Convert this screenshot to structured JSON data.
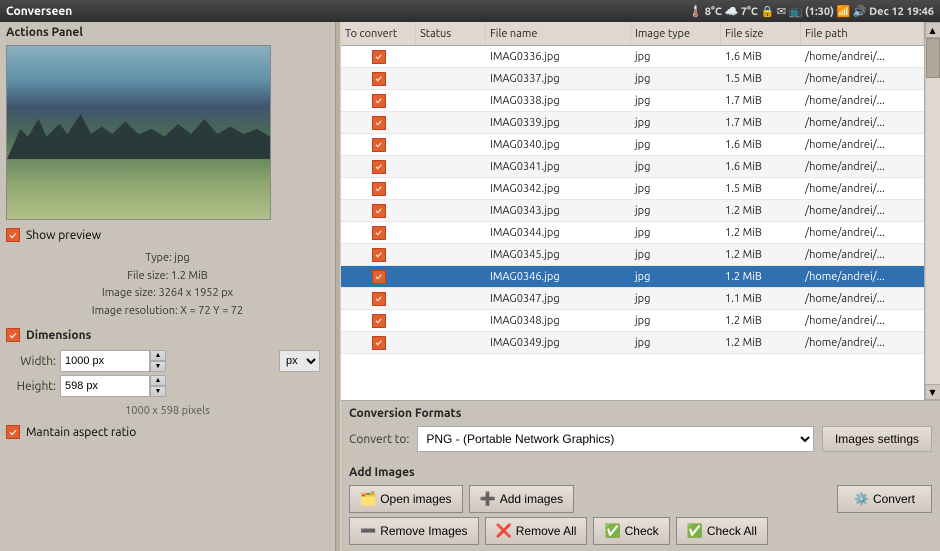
{
  "titlebar": {
    "title": "Converseen",
    "system_icons": "🌡️ 8°C  ☁️ 7°C  🔒  ✉  📺 (1:30)  📶  🔊  Dec 12 19:46"
  },
  "left_panel": {
    "title": "Actions Panel",
    "show_preview": "Show preview",
    "meta": {
      "type_label": "Type:",
      "type_value": "jpg",
      "filesize_label": "File size:",
      "filesize_value": "1.2 MiB",
      "imgsize_label": "Image size:",
      "imgsize_value": "3264 x 1952 px",
      "resolution_label": "Image resolution:",
      "resolution_value": "X = 72 Y = 72"
    },
    "dimensions": {
      "title": "Dimensions",
      "width_label": "Width:",
      "width_value": "1000 px",
      "height_label": "Height:",
      "height_value": "598 px",
      "pixels_display": "1000 x 598 pixels",
      "unit": "px",
      "maintain_label": "Mantain aspect ratio"
    }
  },
  "file_list": {
    "columns": [
      "To convert",
      "Status",
      "File name",
      "Image type",
      "File size",
      "File path"
    ],
    "rows": [
      {
        "filename": "IMAG0336.jpg",
        "type": "jpg",
        "size": "1.6 MiB",
        "path": "/home/andrei/..."
      },
      {
        "filename": "IMAG0337.jpg",
        "type": "jpg",
        "size": "1.5 MiB",
        "path": "/home/andrei/..."
      },
      {
        "filename": "IMAG0338.jpg",
        "type": "jpg",
        "size": "1.7 MiB",
        "path": "/home/andrei/..."
      },
      {
        "filename": "IMAG0339.jpg",
        "type": "jpg",
        "size": "1.7 MiB",
        "path": "/home/andrei/..."
      },
      {
        "filename": "IMAG0340.jpg",
        "type": "jpg",
        "size": "1.6 MiB",
        "path": "/home/andrei/..."
      },
      {
        "filename": "IMAG0341.jpg",
        "type": "jpg",
        "size": "1.6 MiB",
        "path": "/home/andrei/..."
      },
      {
        "filename": "IMAG0342.jpg",
        "type": "jpg",
        "size": "1.5 MiB",
        "path": "/home/andrei/..."
      },
      {
        "filename": "IMAG0343.jpg",
        "type": "jpg",
        "size": "1.2 MiB",
        "path": "/home/andrei/..."
      },
      {
        "filename": "IMAG0344.jpg",
        "type": "jpg",
        "size": "1.2 MiB",
        "path": "/home/andrei/..."
      },
      {
        "filename": "IMAG0345.jpg",
        "type": "jpg",
        "size": "1.2 MiB",
        "path": "/home/andrei/..."
      },
      {
        "filename": "IMAG0346.jpg",
        "type": "jpg",
        "size": "1.2 MiB",
        "path": "/home/andrei/..."
      },
      {
        "filename": "IMAG0347.jpg",
        "type": "jpg",
        "size": "1.1 MiB",
        "path": "/home/andrei/..."
      },
      {
        "filename": "IMAG0348.jpg",
        "type": "jpg",
        "size": "1.2 MiB",
        "path": "/home/andrei/..."
      },
      {
        "filename": "IMAG0349.jpg",
        "type": "jpg",
        "size": "1.2 MiB",
        "path": "/home/andrei/..."
      }
    ],
    "selected_row": 10
  },
  "conversion": {
    "section_title": "Conversion Formats",
    "convert_to_label": "Convert to:",
    "convert_to_value": "PNG - (Portable Network Graphics)",
    "img_settings_btn": "Images settings"
  },
  "add_images": {
    "section_title": "Add Images",
    "open_images_btn": "Open images",
    "add_images_btn": "Add images",
    "remove_images_btn": "Remove Images",
    "remove_all_btn": "Remove All",
    "check_btn": "Check",
    "check_all_btn": "Check All",
    "convert_btn": "Convert"
  }
}
